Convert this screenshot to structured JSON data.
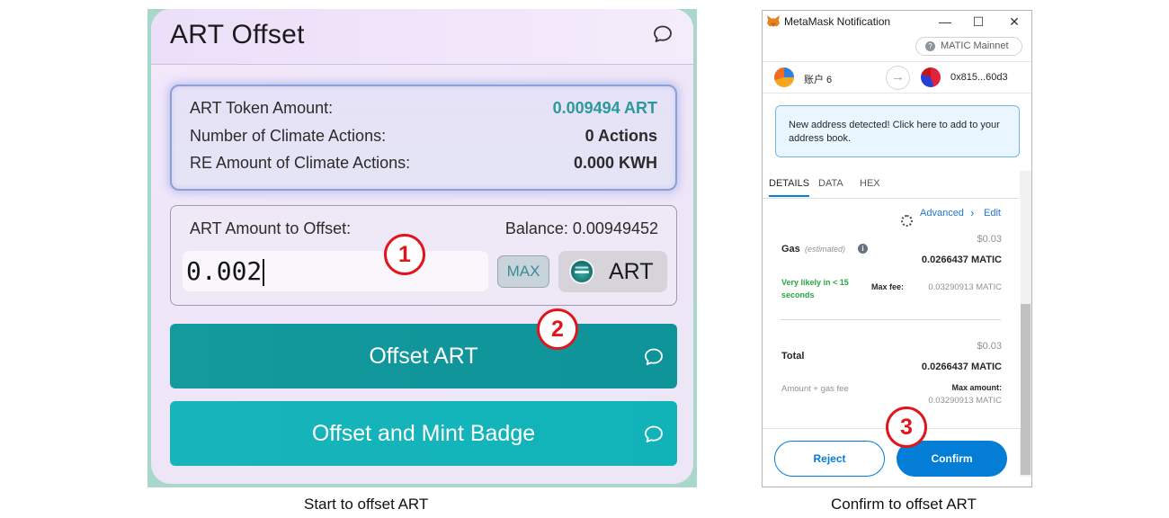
{
  "left_panel": {
    "title": "ART Offset",
    "info": {
      "token_amount_label": "ART Token Amount:",
      "token_amount_value": "0.009494 ART",
      "climate_actions_label": "Number of Climate Actions:",
      "climate_actions_value": "0 Actions",
      "re_amount_label": "RE Amount of Climate Actions:",
      "re_amount_value": "0.000 KWH"
    },
    "offset_form": {
      "amount_label": "ART Amount to Offset:",
      "balance": "Balance: 0.00949452",
      "input_value": "0.002",
      "max_label": "MAX",
      "token_symbol": "ART"
    },
    "buttons": {
      "offset": "Offset ART",
      "offset_mint": "Offset and Mint Badge"
    },
    "caption": "Start to offset ART"
  },
  "steps": [
    "1",
    "2",
    "3"
  ],
  "metamask": {
    "window_title": "MetaMask Notification",
    "window_controls": {
      "minimize": "—",
      "maximize": "☐",
      "close": "✕"
    },
    "network": "MATIC Mainnet",
    "network_icon": "?",
    "from_account": "账户 6",
    "to_address": "0x815...60d3",
    "arrow": "→",
    "notice": "New address detected! Click here to add to your address book.",
    "tabs": [
      "DETAILS",
      "DATA",
      "HEX"
    ],
    "advanced_label": "Advanced",
    "edit_label": "Edit",
    "gas": {
      "label": "Gas",
      "estimated": "(estimated)",
      "info_icon": "i",
      "fiat": "$0.03",
      "amount": "0.0266437 MATIC",
      "likely": "Very likely in < 15 seconds",
      "max_fee_label": "Max fee:",
      "max_fee_value": "0.03290913 MATIC"
    },
    "total": {
      "label": "Total",
      "fiat": "$0.03",
      "amount": "0.0266437 MATIC",
      "sub_label": "Amount + gas fee",
      "max_amount_label": "Max amount:",
      "max_amount_value": "0.03290913 MATIC"
    },
    "reject_label": "Reject",
    "confirm_label": "Confirm",
    "caption": "Confirm to offset ART"
  },
  "colors": {
    "teal_primary": "#0e9399",
    "teal_secondary": "#11b3b9",
    "metamask_blue": "#037dd6",
    "step_red": "#e0161c",
    "success_green": "#28a745"
  }
}
